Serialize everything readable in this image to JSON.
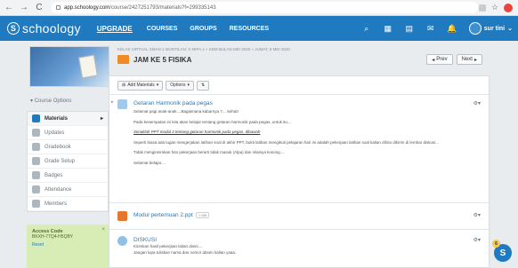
{
  "browser": {
    "url_host": "app.schoology.com",
    "url_path": "/course/2427251793/materials?f=299335143"
  },
  "header": {
    "brand": "schoology",
    "brand_badge": "S",
    "upgrade": "UPGRADE",
    "nav": [
      "COURSES",
      "GROUPS",
      "RESOURCES"
    ],
    "user_name": "sur tini"
  },
  "sidebar": {
    "course_options": "Course Options",
    "items": [
      {
        "label": "Materials",
        "icon": "materials-icon"
      },
      {
        "label": "Updates",
        "icon": "updates-icon"
      },
      {
        "label": "Gradebook",
        "icon": "gradebook-icon"
      },
      {
        "label": "Grade Setup",
        "icon": "grade-setup-icon"
      },
      {
        "label": "Badges",
        "icon": "badges-icon"
      },
      {
        "label": "Attendance",
        "icon": "attendance-icon"
      },
      {
        "label": "Members",
        "icon": "members-icon"
      }
    ],
    "access_code": {
      "title": "Access Code",
      "code": "BKXH-77Q4-H5QBY",
      "reset": "Reset"
    }
  },
  "main": {
    "breadcrumb": "KELAS VIRTUAL SMAN 1 MUNTILAN: X MIPA 4 » KBM BULAN MEI 2020 » JUMAT, 8 MEI 2020",
    "folder_title": "JAM KE 5 FISIKA",
    "pager": {
      "prev": "Prev",
      "next": "Next"
    },
    "toolbar": {
      "add_materials": "Add Materials",
      "options": "Options"
    },
    "items": [
      {
        "title": "Getaran Harmonik pada pegas",
        "paragraphs": [
          "Selamat pagi anak-anak....Bagaimana kabarnya ?... Sehat!",
          "Pada kesempatan ini kita akan belajar tentang getaran harmonik pada pegas, untuk itu...",
          "Simaklah PPT modul 2 tentang getaran harmonik pada pegas, dibawah",
          "Seperti biasa ada tugas mengerjakan latihan soal di akhir PPT, bukti latihan mengikuti pelajaran hari ini adalah pekerjaan latihan soal kalian difoto dikirim di lembar diskusi...",
          "Tidak menginnimkan foto pekerjaan berarti tidak masuk (Alpa) dan nilainya kosong....",
          "Selamat belajar...."
        ]
      },
      {
        "title": "Modul pertemuan 2.ppt",
        "size": "1 MB"
      },
      {
        "title": "DISKUSI",
        "paragraphs": [
          "Kirimkan hasil pekerjaan latian disini....",
          "Jangan lupa tuliskan nama dan nomor absen kalian yaaa.."
        ]
      }
    ]
  },
  "chat_fab": {
    "label": "S",
    "count": "6"
  }
}
